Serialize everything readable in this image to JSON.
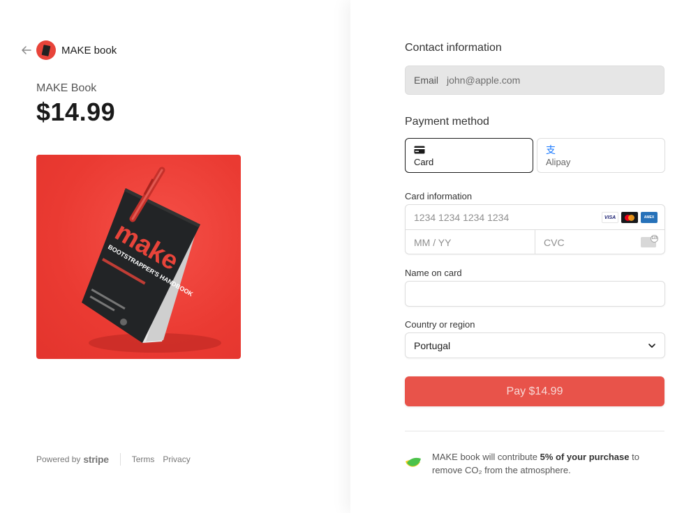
{
  "left": {
    "brand_name": "MAKE book",
    "product_name": "MAKE Book",
    "price": "$14.99",
    "image_alt": "MAKE Bootstrapper's Handbook",
    "footer": {
      "powered_by": "Powered by",
      "stripe": "stripe",
      "terms": "Terms",
      "privacy": "Privacy"
    }
  },
  "right": {
    "contact_title": "Contact information",
    "email_label": "Email",
    "email_value": "john@apple.com",
    "payment_title": "Payment method",
    "methods": [
      {
        "label": "Card",
        "icon": "card-icon",
        "active": true
      },
      {
        "label": "Alipay",
        "icon": "alipay-icon",
        "active": false
      }
    ],
    "card_info_label": "Card information",
    "card_number_placeholder": "1234 1234 1234 1234",
    "card_brands": [
      "VISA",
      "Mastercard",
      "AMEX"
    ],
    "expiry_placeholder": "MM / YY",
    "cvc_placeholder": "CVC",
    "name_label": "Name on card",
    "name_value": "",
    "country_label": "Country or region",
    "country_value": "Portugal",
    "pay_button": "Pay $14.99",
    "climate": {
      "before": "MAKE book will contribute ",
      "bold": "5% of your purchase",
      "after": " to remove CO₂ from the atmosphere."
    },
    "colors": {
      "accent": "#e8534a",
      "climate_green": "#4cc24a",
      "climate_yellow": "#f5d020"
    }
  }
}
